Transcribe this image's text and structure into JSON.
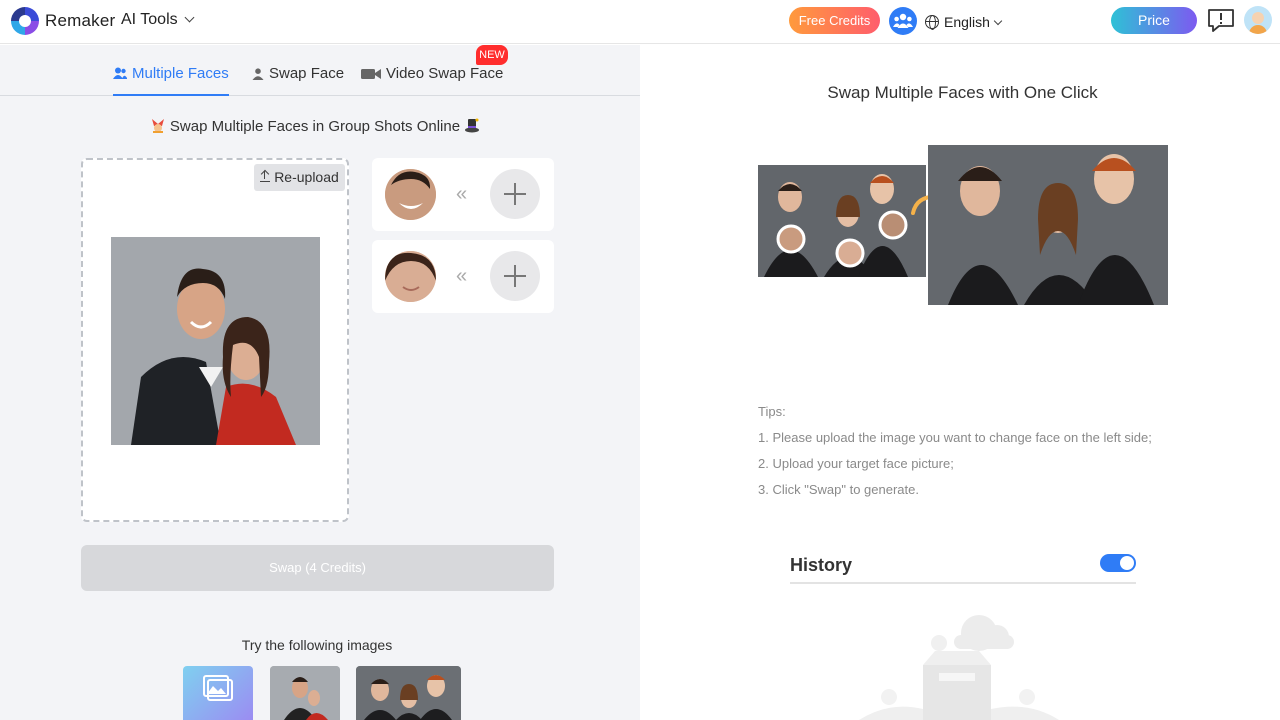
{
  "header": {
    "brand": "Remaker",
    "ai_tools": "AI Tools",
    "free_credits": "Free Credits",
    "language": "English",
    "price": "Price"
  },
  "tabs": [
    {
      "label": "Multiple Faces",
      "active": true
    },
    {
      "label": "Swap Face",
      "active": false
    },
    {
      "label": "Video Swap Face",
      "active": false,
      "badge": "NEW"
    }
  ],
  "left": {
    "subtitle": "Swap Multiple Faces in Group Shots Online",
    "reupload": "Re-upload",
    "face_pairs": [
      {
        "arrows": "«"
      },
      {
        "arrows": "«"
      }
    ],
    "swap_button": "Swap (4 Credits)",
    "try_label": "Try the following images"
  },
  "right": {
    "title": "Swap Multiple Faces with One Click",
    "tips_title": "Tips:",
    "tips": [
      "1. Please upload the image you want to change face on the left side;",
      "2. Upload your target face picture;",
      "3. Click \"Swap\" to generate."
    ],
    "history_title": "History",
    "history_toggle_on": true
  },
  "colors": {
    "accent": "#2f7cf6",
    "new_badge": "#ff2d2d",
    "free_credits_gradient": [
      "#ff9a3c",
      "#ff5d6c"
    ],
    "price_gradient": [
      "#2ec1d6",
      "#7d5af0"
    ]
  }
}
